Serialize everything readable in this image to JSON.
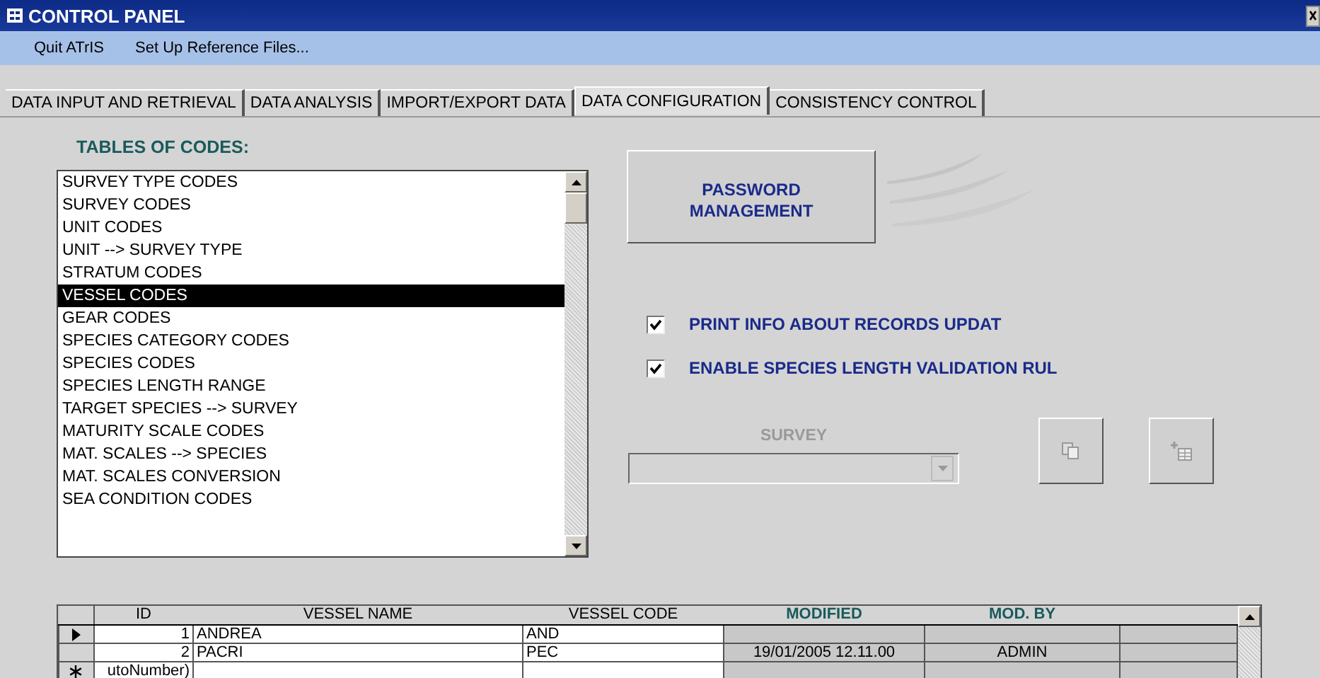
{
  "window": {
    "title": "CONTROL PANEL"
  },
  "menu": [
    "Quit ATrIS",
    "Set Up Reference Files..."
  ],
  "tabs": [
    {
      "label": "DATA INPUT AND RETRIEVAL",
      "selected": false
    },
    {
      "label": "DATA ANALYSIS",
      "selected": false
    },
    {
      "label": "IMPORT/EXPORT DATA",
      "selected": false
    },
    {
      "label": "DATA CONFIGURATION",
      "selected": true
    },
    {
      "label": "CONSISTENCY CONTROL",
      "selected": false
    }
  ],
  "tables_heading": "TABLES OF CODES:",
  "tables": [
    {
      "label": "SURVEY TYPE CODES",
      "selected": false
    },
    {
      "label": "SURVEY CODES",
      "selected": false
    },
    {
      "label": "UNIT CODES",
      "selected": false
    },
    {
      "label": "UNIT --> SURVEY TYPE",
      "selected": false
    },
    {
      "label": "STRATUM CODES",
      "selected": false
    },
    {
      "label": "VESSEL CODES",
      "selected": true
    },
    {
      "label": "GEAR CODES",
      "selected": false
    },
    {
      "label": "SPECIES CATEGORY CODES",
      "selected": false
    },
    {
      "label": "SPECIES CODES",
      "selected": false
    },
    {
      "label": "SPECIES LENGTH RANGE",
      "selected": false
    },
    {
      "label": "TARGET SPECIES --> SURVEY",
      "selected": false
    },
    {
      "label": "MATURITY SCALE CODES",
      "selected": false
    },
    {
      "label": "MAT. SCALES --> SPECIES",
      "selected": false
    },
    {
      "label": "MAT. SCALES CONVERSION",
      "selected": false
    },
    {
      "label": "SEA CONDITION CODES",
      "selected": false
    }
  ],
  "password_button": "PASSWORD\nMANAGEMENT",
  "options": [
    {
      "label": "PRINT INFO ABOUT RECORDS UPDAT",
      "checked": true
    },
    {
      "label": "ENABLE SPECIES LENGTH VALIDATION RUL",
      "checked": true
    }
  ],
  "survey": {
    "label": "SURVEY",
    "disabled": true
  },
  "grid": {
    "columns": [
      {
        "label": "ID",
        "locked": false
      },
      {
        "label": "VESSEL NAME",
        "locked": false
      },
      {
        "label": "VESSEL CODE",
        "locked": false
      },
      {
        "label": "MODIFIED",
        "locked": true
      },
      {
        "label": "MOD. BY",
        "locked": true
      }
    ],
    "rows": [
      {
        "kind": "current",
        "cells": [
          "1",
          "ANDREA",
          "AND",
          "",
          ""
        ]
      },
      {
        "kind": "record",
        "cells": [
          "2",
          "PACRI",
          "PEC",
          "19/01/2005 12.11.00",
          "ADMIN"
        ]
      },
      {
        "kind": "new",
        "cells": [
          "utoNumber)",
          "",
          "",
          "",
          ""
        ]
      }
    ]
  }
}
